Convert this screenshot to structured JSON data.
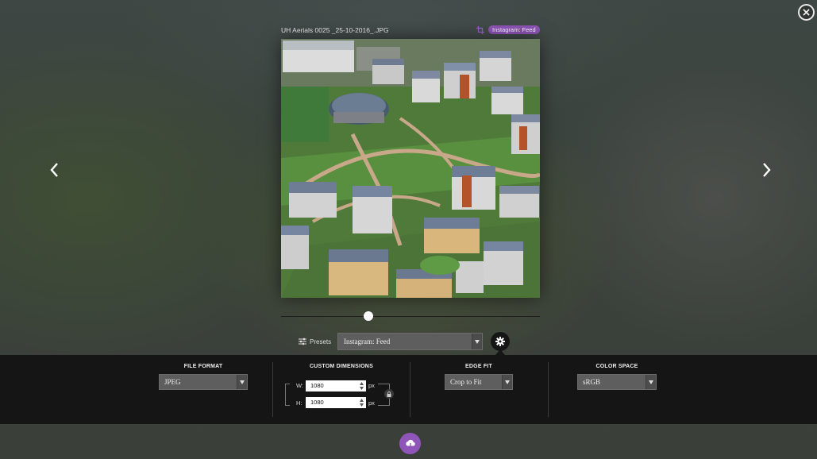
{
  "file": {
    "name": "UH Aerials 0025 _25-10-2016_.JPG"
  },
  "badge": {
    "label": "Instagram: Feed",
    "color": "#8f55b8"
  },
  "zoom": {
    "level_fraction": 0.33
  },
  "presets": {
    "button_label": "Presets",
    "selected": "Instagram: Feed"
  },
  "options": {
    "file_format": {
      "title": "FILE FORMAT",
      "value": "JPEG"
    },
    "custom_dimensions": {
      "title": "CUSTOM DIMENSIONS",
      "width_label": "W:",
      "width_value": "1080",
      "height_label": "H:",
      "height_value": "1080",
      "unit": "px"
    },
    "edge_fit": {
      "title": "EDGE FIT",
      "value": "Crop to Fit"
    },
    "color_space": {
      "title": "COLOR SPACE",
      "value": "sRGB"
    }
  },
  "icons": [
    "close-icon",
    "chevron-left-icon",
    "chevron-right-icon",
    "crop-icon",
    "sliders-icon",
    "chevron-down-icon",
    "gear-icon",
    "lock-icon",
    "cloud-download-icon"
  ],
  "colors": {
    "accent": "#8f55b8",
    "panel": "#151515"
  }
}
